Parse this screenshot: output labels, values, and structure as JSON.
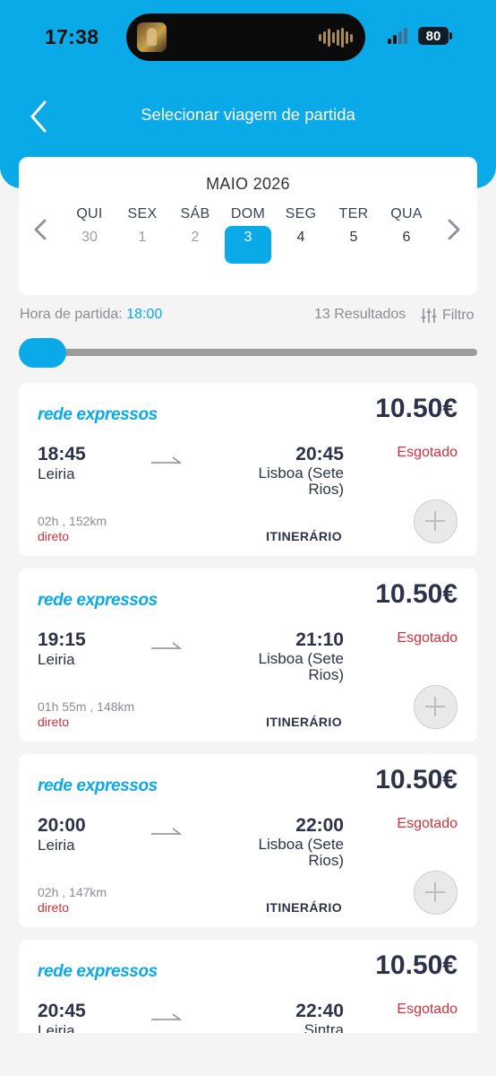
{
  "status_bar": {
    "time": "17:38",
    "battery": "80"
  },
  "header": {
    "title": "Selecionar viagem de partida"
  },
  "calendar": {
    "month": "MAIO 2026",
    "days": [
      {
        "name": "QUI",
        "number": "30"
      },
      {
        "name": "SEX",
        "number": "1"
      },
      {
        "name": "SÁB",
        "number": "2"
      },
      {
        "name": "DOM",
        "number": "3"
      },
      {
        "name": "SEG",
        "number": "4"
      },
      {
        "name": "TER",
        "number": "5"
      },
      {
        "name": "QUA",
        "number": "6"
      }
    ],
    "selected_index": 3
  },
  "filters": {
    "departure_label": "Hora de partida:",
    "departure_value": "18:00",
    "results": "13 Resultados",
    "filter_label": "Filtro"
  },
  "trips": [
    {
      "brand": "rede expressos",
      "price": "10.50€",
      "dep_time": "18:45",
      "dep_city": "Leiria",
      "arr_time": "20:45",
      "arr_city": "Lisboa (Sete Rios)",
      "status": "Esgotado",
      "duration": "02h , 152km",
      "type": "direto",
      "itinerary": "ITINERÁRIO"
    },
    {
      "brand": "rede expressos",
      "price": "10.50€",
      "dep_time": "19:15",
      "dep_city": "Leiria",
      "arr_time": "21:10",
      "arr_city": "Lisboa (Sete Rios)",
      "status": "Esgotado",
      "duration": "01h 55m , 148km",
      "type": "direto",
      "itinerary": "ITINERÁRIO"
    },
    {
      "brand": "rede expressos",
      "price": "10.50€",
      "dep_time": "20:00",
      "dep_city": "Leiria",
      "arr_time": "22:00",
      "arr_city": "Lisboa (Sete Rios)",
      "status": "Esgotado",
      "duration": "02h , 147km",
      "type": "direto",
      "itinerary": "ITINERÁRIO"
    },
    {
      "brand": "rede expressos",
      "price": "10.50€",
      "dep_time": "20:45",
      "dep_city": "Leiria",
      "arr_time": "22:40",
      "arr_city": "Sintra",
      "status": "Esgotado",
      "duration": "",
      "type": "",
      "itinerary": ""
    }
  ],
  "colors": {
    "accent": "#0aa9e8",
    "sold_out": "#d0303b",
    "text_dark": "#2c3348"
  },
  "icons": {
    "back": "chevron-left-icon",
    "prev_week": "chevron-left-icon",
    "next_week": "chevron-right-icon",
    "filter": "sliders-icon",
    "add": "plus-icon",
    "route": "arrow-right-icon"
  }
}
